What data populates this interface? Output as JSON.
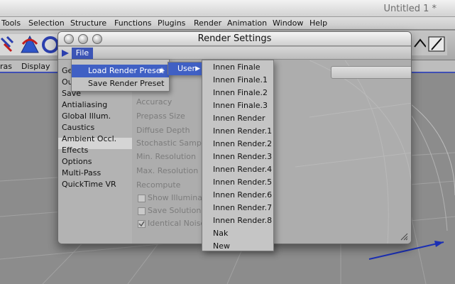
{
  "app": {
    "document_title": "Untitled 1 *",
    "menu": [
      "Tools",
      "Selection",
      "Structure",
      "Functions",
      "Plugins",
      "Render",
      "Animation",
      "Window",
      "Help"
    ],
    "viewport_menu": [
      "ras",
      "Display"
    ]
  },
  "render_settings": {
    "title": "Render Settings",
    "file_menu_label": "File",
    "sidebar": [
      "Gen",
      "Out",
      "Save",
      "Antialiasing",
      "Global Illum.",
      "Caustics",
      "Ambient Occl.",
      "Effects",
      "Options",
      "Multi-Pass",
      "QuickTime VR"
    ],
    "selected_sidebar": "Global Illum.",
    "fields": [
      "Accuracy",
      "Prepass Size",
      "Diffuse Depth",
      "Stochastic Samples",
      "Min. Resolution",
      "Max. Resolution",
      "Recompute"
    ],
    "checkboxes": [
      {
        "label": "Show Illuminati",
        "checked": false
      },
      {
        "label": "Save Solution",
        "checked": false
      },
      {
        "label": "Identical Noise D",
        "checked": true
      }
    ]
  },
  "menus": {
    "file_menu": [
      {
        "label": "Load Render Preset",
        "highlighted": true,
        "submenu": true
      },
      {
        "label": "Save Render Preset",
        "highlighted": false,
        "submenu": false
      }
    ],
    "user_menu": {
      "label": "User",
      "highlighted": true,
      "submenu": true
    },
    "presets": [
      "Innen Finale",
      "Innen Finale.1",
      "Innen Finale.2",
      "Innen Finale.3",
      "Innen Render",
      "Innen Render.1",
      "Innen Render.2",
      "Innen Render.3",
      "Innen Render.4",
      "Innen Render.5",
      "Innen Render.6",
      "Innen Render.7",
      "Innen Render.8",
      "Nak",
      "New"
    ]
  },
  "colors": {
    "highlight": "#4060c4",
    "file_active": "#3c55b6",
    "window_bg": "#ababab",
    "menu_bg": "#c3c3c3"
  }
}
